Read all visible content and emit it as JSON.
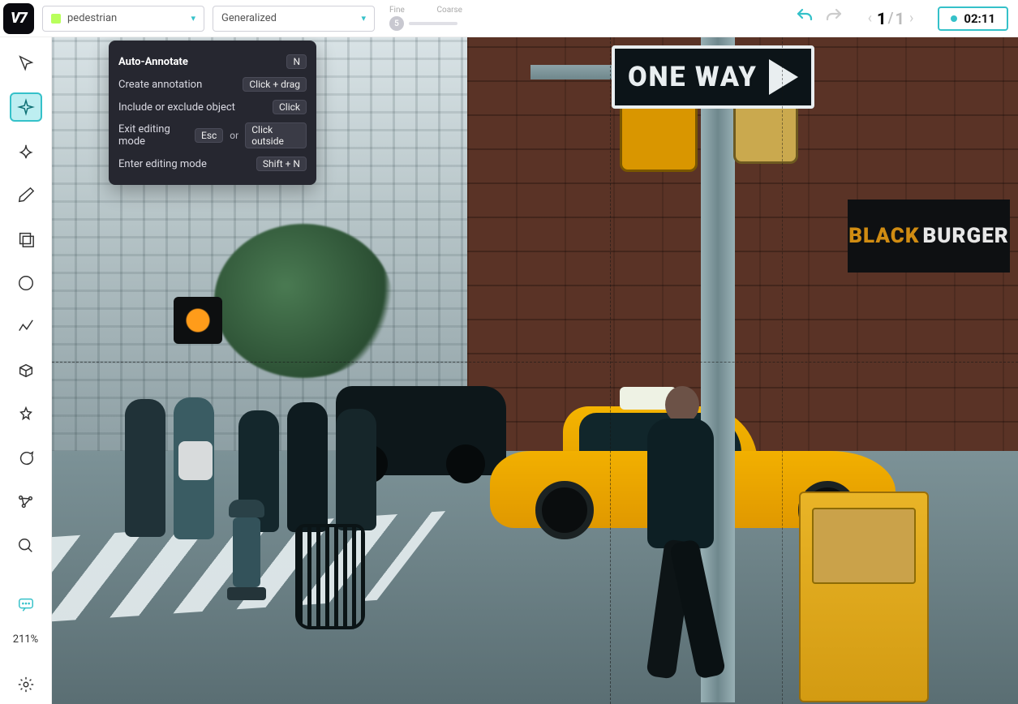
{
  "logo_text": "V7",
  "topbar": {
    "class_label": "pedestrian",
    "model_label": "Generalized",
    "slider_fine_label": "Fine",
    "slider_coarse_label": "Coarse",
    "slider_value": "5",
    "page_current": "1",
    "page_total": "1",
    "timer": "02:11"
  },
  "tooltip": {
    "title_label": "Auto-Annotate",
    "title_key": "N",
    "create_label": "Create annotation",
    "create_key": "Click + drag",
    "include_label": "Include or exclude object",
    "include_key": "Click",
    "exit_label": "Exit editing mode",
    "exit_key1": "Esc",
    "exit_or": "or",
    "exit_key2": "Click outside",
    "enter_label": "Enter editing mode",
    "enter_key": "Shift + N"
  },
  "sidebar": {
    "zoom": "211%"
  },
  "scene": {
    "oneway_text": "ONE WAY",
    "burger_prefix": "BLACK",
    "burger_text": "BURGER"
  }
}
